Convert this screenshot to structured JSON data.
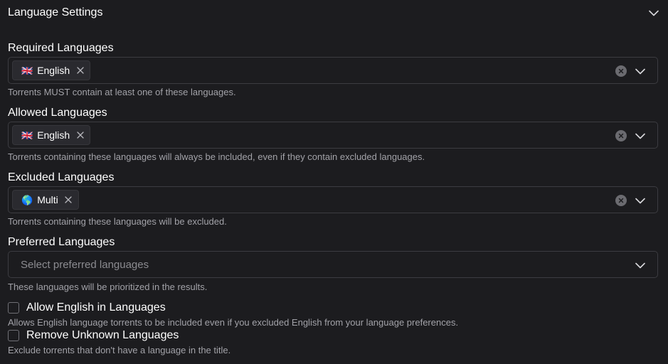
{
  "section": {
    "title": "Language Settings",
    "collapse_icon": "chevron-down-icon"
  },
  "required": {
    "label": "Required Languages",
    "tag": {
      "flag": "🇬🇧",
      "label": "English"
    },
    "help": "Torrents MUST contain at least one of these languages."
  },
  "allowed": {
    "label": "Allowed Languages",
    "tag": {
      "flag": "🇬🇧",
      "label": "English"
    },
    "help": "Torrents containing these languages will always be included, even if they contain excluded languages."
  },
  "excluded": {
    "label": "Excluded Languages",
    "tag": {
      "flag": "🌎",
      "label": "Multi"
    },
    "help": "Torrents containing these languages will be excluded."
  },
  "preferred": {
    "label": "Preferred Languages",
    "placeholder": "Select preferred languages",
    "help": "These languages will be prioritized in the results."
  },
  "allow_english": {
    "label": "Allow English in Languages",
    "checked": false,
    "help": "Allows English language torrents to be included even if you excluded English from your language preferences."
  },
  "remove_unknown": {
    "label": "Remove Unknown Languages",
    "checked": false,
    "help": "Exclude torrents that don't have a language in the title."
  },
  "colors": {
    "background": "#1c1c1f",
    "border": "#3c3c41",
    "tag_bg": "#2a2a2f",
    "help_text": "#a2a2a8"
  }
}
